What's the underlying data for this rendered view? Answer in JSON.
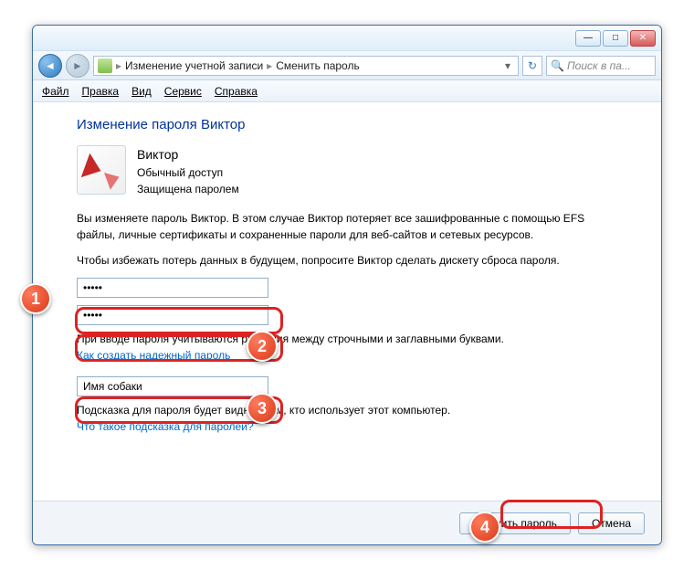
{
  "titlebar": {
    "min_icon": "—",
    "max_icon": "□",
    "close_icon": "✕"
  },
  "nav": {
    "back_glyph": "◄",
    "fwd_glyph": "►",
    "breadcrumb1": "Изменение учетной записи",
    "breadcrumb2": "Сменить пароль",
    "sep": "▸",
    "dropdown_glyph": "▾",
    "refresh_glyph": "↻",
    "search_placeholder": "Поиск в па..."
  },
  "menu": {
    "file": "Файл",
    "edit": "Правка",
    "view": "Вид",
    "tools": "Сервис",
    "help": "Справка"
  },
  "heading": "Изменение пароля Виктор",
  "user": {
    "name": "Виктор",
    "role": "Обычный доступ",
    "status": "Защищена паролем"
  },
  "warn1": "Вы изменяете пароль Виктор. В этом случае Виктор потеряет все зашифрованные с помощью EFS файлы, личные сертификаты и сохраненные пароли для веб-сайтов и сетевых ресурсов.",
  "warn2": "Чтобы избежать потерь данных в будущем, попросите Виктор сделать дискету сброса пароля.",
  "inputs": {
    "new_password": "•••••",
    "confirm_password": "•••••",
    "hint_value": "Имя собаки"
  },
  "case_hint": "При вводе пароля учитываются различия между строчными и заглавными буквами.",
  "link_strong": "Как создать надежный пароль",
  "hint_help": "Подсказка для пароля будет видна всем, кто использует этот компьютер.",
  "link_hint": "Что такое подсказка для паролей?",
  "buttons": {
    "submit": "Сменить пароль",
    "cancel": "Отмена"
  },
  "badges": {
    "b1": "1",
    "b2": "2",
    "b3": "3",
    "b4": "4"
  }
}
